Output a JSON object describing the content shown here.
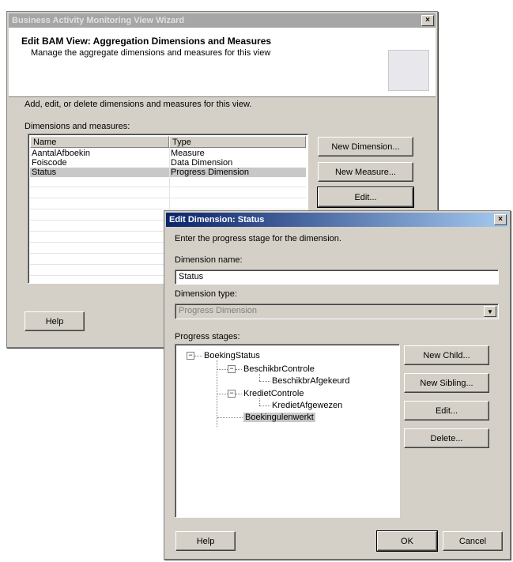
{
  "wizard": {
    "title": "Business Activity Monitoring View Wizard",
    "header_title": "Edit BAM View: Aggregation Dimensions and Measures",
    "header_subtitle": "Manage the aggregate dimensions and measures for this view",
    "instruction": "Add, edit, or delete dimensions and measures for this view.",
    "list_label": "Dimensions and measures:",
    "columns": [
      "Name",
      "Type"
    ],
    "rows": [
      {
        "name": "AantalAfboekin",
        "type": "Measure"
      },
      {
        "name": "Foiscode",
        "type": "Data Dimension"
      },
      {
        "name": "Status",
        "type": "Progress Dimension"
      }
    ],
    "buttons": {
      "new_dimension": "New Dimension...",
      "new_measure": "New Measure...",
      "edit": "Edit...",
      "help": "Help"
    }
  },
  "dialog": {
    "title": "Edit Dimension: Status",
    "instruction": "Enter the progress stage for the dimension.",
    "name_label": "Dimension name:",
    "name_value": "Status",
    "type_label": "Dimension type:",
    "type_value": "Progress Dimension",
    "stages_label": "Progress stages:",
    "tree": {
      "root": "BoekingStatus",
      "child1": "BeschikbrControle",
      "child1_leaf": "BeschikbrAfgekeurd",
      "child2": "KredietControle",
      "child2_leaf": "KredietAfgewezen",
      "child3": "Boekingulenwerkt"
    },
    "buttons": {
      "new_child": "New Child...",
      "new_sibling": "New Sibling...",
      "edit": "Edit...",
      "delete": "Delete...",
      "help": "Help",
      "ok": "OK",
      "cancel": "Cancel"
    },
    "close_glyph": "×"
  },
  "colors": {
    "dialog_face": "#d4d0c8",
    "active_title": "#0a246a",
    "inactive_title": "#a6a6a6",
    "selection": "#c8c8c8"
  },
  "icons": {
    "close": "close-icon",
    "expand": "collapse-icon",
    "dropdown": "chevron-down-icon"
  }
}
